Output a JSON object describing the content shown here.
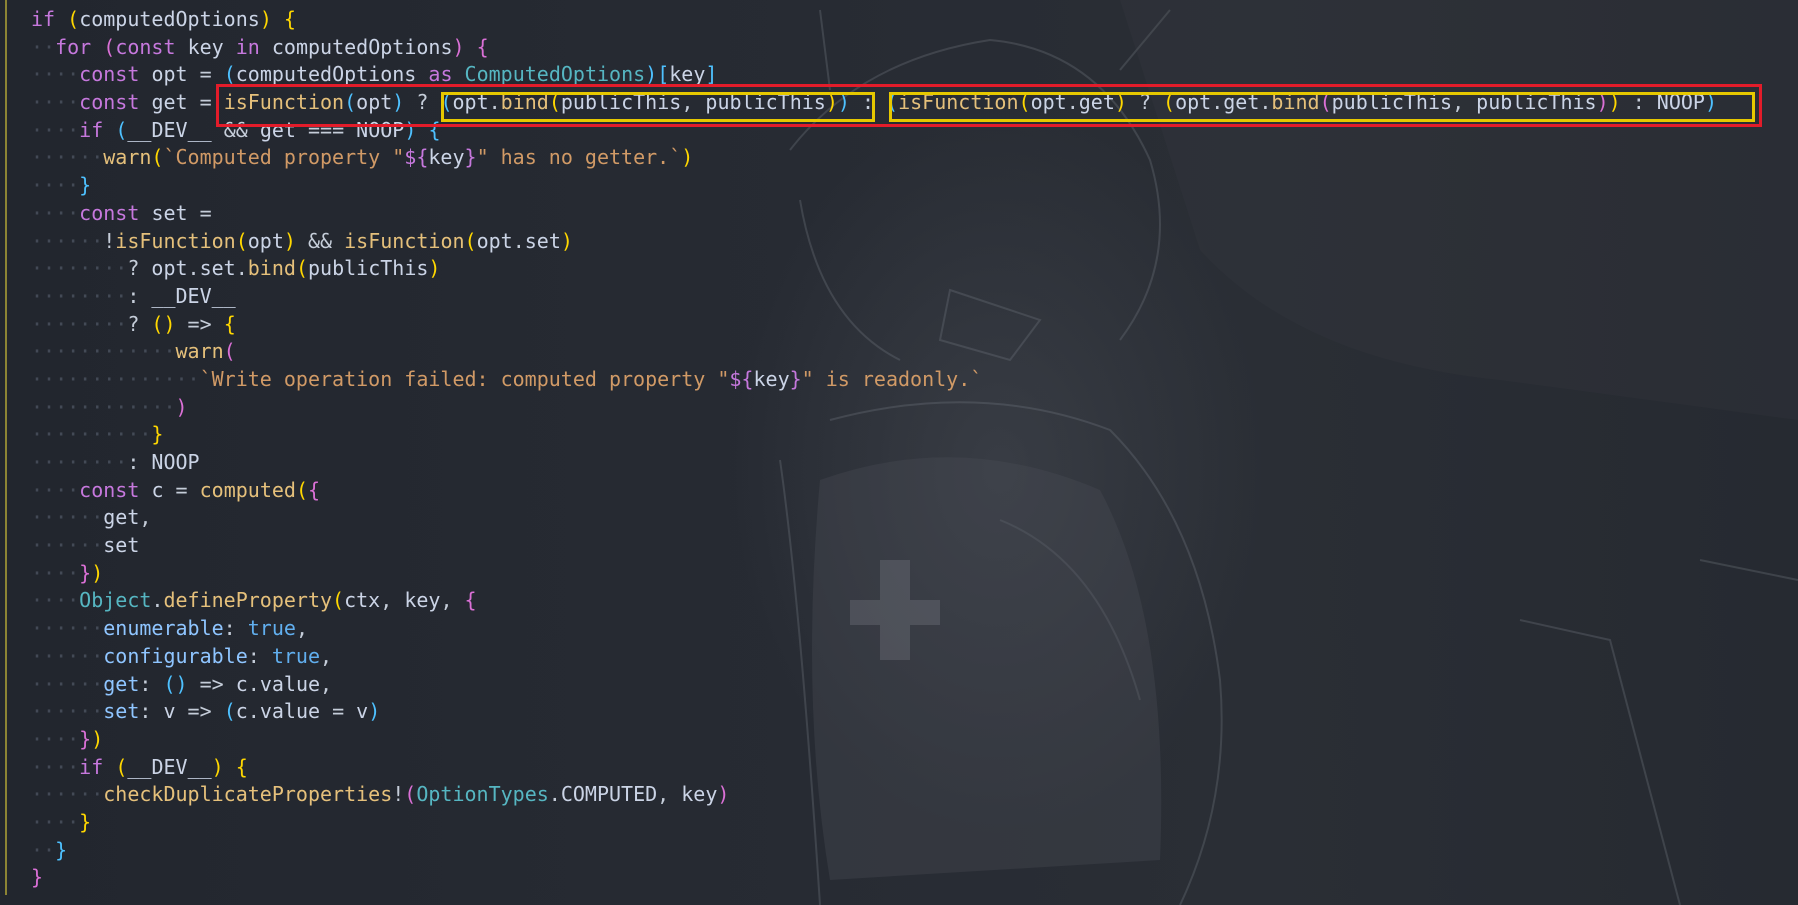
{
  "editor": {
    "language": "typescript",
    "background_art": "anime-character-sketch",
    "colors": {
      "background": "#242831",
      "keyword": "#c678dd",
      "function": "#e5c07b",
      "string": "#d19a66",
      "highlight_red": "#e31c2a",
      "highlight_yellow": "#e6c800"
    }
  },
  "code": {
    "lines": [
      {
        "i": "",
        "t": [
          [
            "kw",
            "if"
          ],
          [
            "op",
            " "
          ],
          [
            "br1",
            "("
          ],
          [
            "id",
            "computedOptions"
          ],
          [
            "br1",
            ")"
          ],
          [
            "op",
            " "
          ],
          [
            "br1",
            "{"
          ]
        ]
      },
      {
        "i": "  ",
        "t": [
          [
            "kw",
            "for"
          ],
          [
            "op",
            " "
          ],
          [
            "br2",
            "("
          ],
          [
            "kw",
            "const"
          ],
          [
            "op",
            " "
          ],
          [
            "id",
            "key"
          ],
          [
            "op",
            " "
          ],
          [
            "kw",
            "in"
          ],
          [
            "op",
            " "
          ],
          [
            "id",
            "computedOptions"
          ],
          [
            "br2",
            ")"
          ],
          [
            "op",
            " "
          ],
          [
            "br2",
            "{"
          ]
        ]
      },
      {
        "i": "    ",
        "t": [
          [
            "kw",
            "const"
          ],
          [
            "op",
            " "
          ],
          [
            "id",
            "opt"
          ],
          [
            "op",
            " = "
          ],
          [
            "br3",
            "("
          ],
          [
            "id",
            "computedOptions"
          ],
          [
            "op",
            " "
          ],
          [
            "kw",
            "as"
          ],
          [
            "op",
            " "
          ],
          [
            "ty",
            "ComputedOptions"
          ],
          [
            "br3",
            ")"
          ],
          [
            "br3",
            "["
          ],
          [
            "id",
            "key"
          ],
          [
            "br3",
            "]"
          ]
        ]
      },
      {
        "i": "    ",
        "t": [
          [
            "kw",
            "const"
          ],
          [
            "op",
            " "
          ],
          [
            "id",
            "get"
          ],
          [
            "op",
            " = "
          ],
          [
            "fn",
            "isFunction"
          ],
          [
            "br3",
            "("
          ],
          [
            "id",
            "opt"
          ],
          [
            "br3",
            ")"
          ],
          [
            "op",
            " ? "
          ],
          [
            "br3",
            "("
          ],
          [
            "id",
            "opt"
          ],
          [
            "op",
            "."
          ],
          [
            "fn",
            "bind"
          ],
          [
            "br1",
            "("
          ],
          [
            "id",
            "publicThis"
          ],
          [
            "op",
            ", "
          ],
          [
            "id",
            "publicThis"
          ],
          [
            "br1",
            ")"
          ],
          [
            "br3",
            ")"
          ],
          [
            "op",
            " : "
          ],
          [
            "br3",
            "("
          ],
          [
            "fn",
            "isFunction"
          ],
          [
            "br1",
            "("
          ],
          [
            "id",
            "opt"
          ],
          [
            "op",
            "."
          ],
          [
            "id",
            "get"
          ],
          [
            "br1",
            ")"
          ],
          [
            "op",
            " ? "
          ],
          [
            "br1",
            "("
          ],
          [
            "id",
            "opt"
          ],
          [
            "op",
            "."
          ],
          [
            "id",
            "get"
          ],
          [
            "op",
            "."
          ],
          [
            "fn",
            "bind"
          ],
          [
            "br2",
            "("
          ],
          [
            "id",
            "publicThis"
          ],
          [
            "op",
            ", "
          ],
          [
            "id",
            "publicThis"
          ],
          [
            "br2",
            ")"
          ],
          [
            "br1",
            ")"
          ],
          [
            "op",
            " : "
          ],
          [
            "id",
            "NOOP"
          ],
          [
            "br3",
            ")"
          ]
        ]
      },
      {
        "i": "    ",
        "t": [
          [
            "kw",
            "if"
          ],
          [
            "op",
            " "
          ],
          [
            "br3",
            "("
          ],
          [
            "id",
            "__DEV__"
          ],
          [
            "op",
            " && "
          ],
          [
            "id",
            "get"
          ],
          [
            "op",
            " === "
          ],
          [
            "id",
            "NOOP"
          ],
          [
            "br3",
            ")"
          ],
          [
            "op",
            " "
          ],
          [
            "br3",
            "{"
          ]
        ]
      },
      {
        "i": "      ",
        "t": [
          [
            "fn",
            "warn"
          ],
          [
            "br1",
            "("
          ],
          [
            "st",
            "`Computed property \""
          ],
          [
            "kw",
            "${"
          ],
          [
            "id",
            "key"
          ],
          [
            "kw",
            "}"
          ],
          [
            "st",
            "\" has no getter.`"
          ],
          [
            "br1",
            ")"
          ]
        ]
      },
      {
        "i": "    ",
        "t": [
          [
            "br3",
            "}"
          ]
        ]
      },
      {
        "i": "    ",
        "t": [
          [
            "kw",
            "const"
          ],
          [
            "op",
            " "
          ],
          [
            "id",
            "set"
          ],
          [
            "op",
            " ="
          ]
        ]
      },
      {
        "i": "      ",
        "t": [
          [
            "op",
            "!"
          ],
          [
            "fn",
            "isFunction"
          ],
          [
            "br1",
            "("
          ],
          [
            "id",
            "opt"
          ],
          [
            "br1",
            ")"
          ],
          [
            "op",
            " && "
          ],
          [
            "fn",
            "isFunction"
          ],
          [
            "br1",
            "("
          ],
          [
            "id",
            "opt"
          ],
          [
            "op",
            "."
          ],
          [
            "id",
            "set"
          ],
          [
            "br1",
            ")"
          ]
        ]
      },
      {
        "i": "        ",
        "t": [
          [
            "op",
            "? "
          ],
          [
            "id",
            "opt"
          ],
          [
            "op",
            "."
          ],
          [
            "id",
            "set"
          ],
          [
            "op",
            "."
          ],
          [
            "fn",
            "bind"
          ],
          [
            "br1",
            "("
          ],
          [
            "id",
            "publicThis"
          ],
          [
            "br1",
            ")"
          ]
        ]
      },
      {
        "i": "        ",
        "t": [
          [
            "op",
            ": "
          ],
          [
            "id",
            "__DEV__"
          ]
        ]
      },
      {
        "i": "        ",
        "t": [
          [
            "op",
            "? "
          ],
          [
            "br1",
            "()"
          ],
          [
            "op",
            " => "
          ],
          [
            "br1",
            "{"
          ]
        ]
      },
      {
        "i": "            ",
        "t": [
          [
            "fn",
            "warn"
          ],
          [
            "br2",
            "("
          ]
        ]
      },
      {
        "i": "              ",
        "t": [
          [
            "st",
            "`Write operation failed: computed property \""
          ],
          [
            "kw",
            "${"
          ],
          [
            "id",
            "key"
          ],
          [
            "kw",
            "}"
          ],
          [
            "st",
            "\" is readonly.`"
          ]
        ]
      },
      {
        "i": "            ",
        "t": [
          [
            "br2",
            ")"
          ]
        ]
      },
      {
        "i": "          ",
        "t": [
          [
            "br1",
            "}"
          ]
        ]
      },
      {
        "i": "        ",
        "t": [
          [
            "op",
            ": "
          ],
          [
            "id",
            "NOOP"
          ]
        ]
      },
      {
        "i": "    ",
        "t": [
          [
            "kw",
            "const"
          ],
          [
            "op",
            " "
          ],
          [
            "id",
            "c"
          ],
          [
            "op",
            " = "
          ],
          [
            "fn",
            "computed"
          ],
          [
            "br1",
            "("
          ],
          [
            "br2",
            "{"
          ]
        ]
      },
      {
        "i": "      ",
        "t": [
          [
            "id",
            "get"
          ],
          [
            "op",
            ","
          ]
        ]
      },
      {
        "i": "      ",
        "t": [
          [
            "id",
            "set"
          ]
        ]
      },
      {
        "i": "    ",
        "t": [
          [
            "br2",
            "}"
          ],
          [
            "br1",
            ")"
          ]
        ]
      },
      {
        "i": "    ",
        "t": [
          [
            "ty",
            "Object"
          ],
          [
            "op",
            "."
          ],
          [
            "fn",
            "defineProperty"
          ],
          [
            "br1",
            "("
          ],
          [
            "id",
            "ctx"
          ],
          [
            "op",
            ", "
          ],
          [
            "id",
            "key"
          ],
          [
            "op",
            ", "
          ],
          [
            "br2",
            "{"
          ]
        ]
      },
      {
        "i": "      ",
        "t": [
          [
            "pr",
            "enumerable"
          ],
          [
            "op",
            ": "
          ],
          [
            "bool",
            "true"
          ],
          [
            "op",
            ","
          ]
        ]
      },
      {
        "i": "      ",
        "t": [
          [
            "pr",
            "configurable"
          ],
          [
            "op",
            ": "
          ],
          [
            "bool",
            "true"
          ],
          [
            "op",
            ","
          ]
        ]
      },
      {
        "i": "      ",
        "t": [
          [
            "pr",
            "get"
          ],
          [
            "op",
            ": "
          ],
          [
            "br3",
            "()"
          ],
          [
            "op",
            " => "
          ],
          [
            "id",
            "c"
          ],
          [
            "op",
            "."
          ],
          [
            "id",
            "value"
          ],
          [
            "op",
            ","
          ]
        ]
      },
      {
        "i": "      ",
        "t": [
          [
            "pr",
            "set"
          ],
          [
            "op",
            ": "
          ],
          [
            "id",
            "v"
          ],
          [
            "op",
            " => "
          ],
          [
            "br3",
            "("
          ],
          [
            "id",
            "c"
          ],
          [
            "op",
            "."
          ],
          [
            "id",
            "value"
          ],
          [
            "op",
            " = "
          ],
          [
            "id",
            "v"
          ],
          [
            "br3",
            ")"
          ]
        ]
      },
      {
        "i": "    ",
        "t": [
          [
            "br2",
            "}"
          ],
          [
            "br1",
            ")"
          ]
        ]
      },
      {
        "i": "    ",
        "t": [
          [
            "kw",
            "if"
          ],
          [
            "op",
            " "
          ],
          [
            "br1",
            "("
          ],
          [
            "id",
            "__DEV__"
          ],
          [
            "br1",
            ")"
          ],
          [
            "op",
            " "
          ],
          [
            "br1",
            "{"
          ]
        ]
      },
      {
        "i": "      ",
        "t": [
          [
            "fn",
            "checkDuplicateProperties"
          ],
          [
            "op",
            "!"
          ],
          [
            "br2",
            "("
          ],
          [
            "ty",
            "OptionTypes"
          ],
          [
            "op",
            "."
          ],
          [
            "id",
            "COMPUTED"
          ],
          [
            "op",
            ", "
          ],
          [
            "id",
            "key"
          ],
          [
            "br2",
            ")"
          ]
        ]
      },
      {
        "i": "    ",
        "t": [
          [
            "br1",
            "}"
          ]
        ]
      },
      {
        "i": "  ",
        "t": [
          [
            "br3",
            "}"
          ]
        ]
      },
      {
        "i": "",
        "t": [
          [
            "br2",
            "}"
          ]
        ]
      }
    ]
  },
  "highlights": [
    {
      "color": "red",
      "label": "whole-ternary-expression"
    },
    {
      "color": "yellow",
      "label": "true-branch"
    },
    {
      "color": "yellow",
      "label": "false-branch"
    }
  ]
}
